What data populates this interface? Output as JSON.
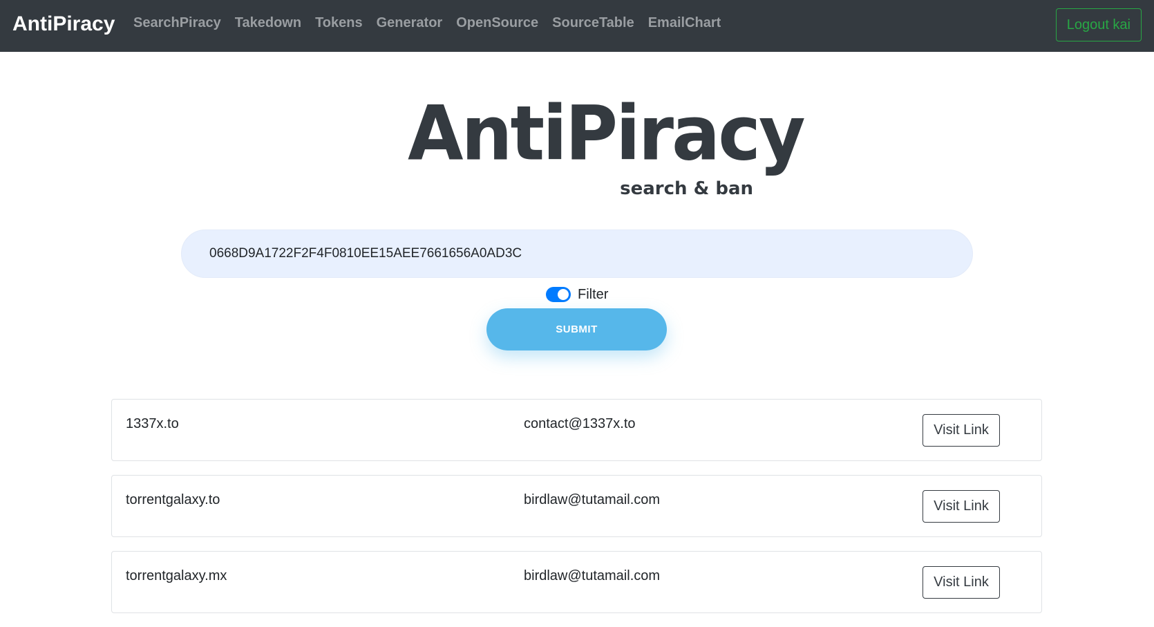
{
  "navbar": {
    "brand": "AntiPiracy",
    "links": [
      "SearchPiracy",
      "Takedown",
      "Tokens",
      "Generator",
      "OpenSource",
      "SourceTable",
      "EmailChart"
    ],
    "logout_label": "Logout kai"
  },
  "logo": {
    "title": "AntiPiracy",
    "subtitle": "search & ban"
  },
  "search": {
    "value": "0668D9A1722F2F4F0810EE15AEE7661656A0AD3C"
  },
  "filter": {
    "label": "Filter",
    "enabled": true
  },
  "submit_label": "SUBMIT",
  "results": [
    {
      "domain": "1337x.to",
      "email": "contact@1337x.to",
      "action": "Visit Link"
    },
    {
      "domain": "torrentgalaxy.to",
      "email": "birdlaw@tutamail.com",
      "action": "Visit Link"
    },
    {
      "domain": "torrentgalaxy.mx",
      "email": "birdlaw@tutamail.com",
      "action": "Visit Link"
    }
  ],
  "colors": {
    "navbar_bg": "#343a40",
    "nav_link": "#9a9ea2",
    "logout": "#28a745",
    "input_bg": "#e8f0fe",
    "toggle": "#007bff",
    "submit": "#56b7ea"
  }
}
